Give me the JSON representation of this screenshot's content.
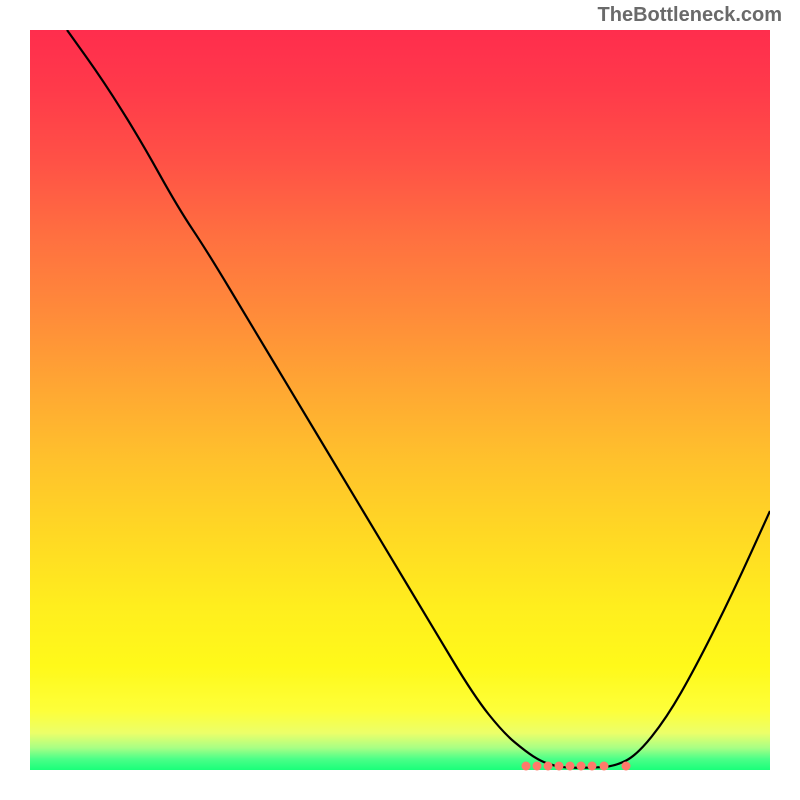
{
  "watermark": "TheBottleneck.com",
  "chart_data": {
    "type": "line",
    "title": "",
    "xlabel": "",
    "ylabel": "",
    "xlim": [
      0,
      100
    ],
    "ylim": [
      0,
      100
    ],
    "gradient": "vertical red-orange-yellow-green (top to bottom)",
    "series": [
      {
        "name": "bottleneck-curve",
        "x": [
          5,
          10,
          15,
          20,
          24,
          30,
          36,
          42,
          48,
          54,
          60,
          64,
          67,
          69,
          71,
          73,
          76,
          79,
          82,
          86,
          90,
          95,
          100
        ],
        "y": [
          100,
          93,
          85,
          76,
          70,
          60,
          50,
          40,
          30,
          20,
          10,
          5,
          2.5,
          1.2,
          0.5,
          0.3,
          0.3,
          0.5,
          2,
          7,
          14,
          24,
          35
        ]
      }
    ],
    "markers": {
      "name": "highlight-points",
      "color": "#ff7a6a",
      "points_x": [
        67,
        68.5,
        70,
        71.5,
        73,
        74.5,
        76,
        77.5,
        80.5
      ],
      "y": 0.6
    }
  }
}
